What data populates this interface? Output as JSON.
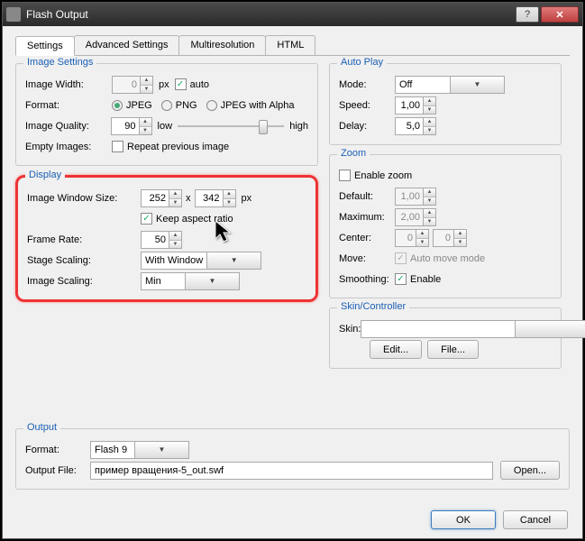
{
  "window": {
    "title": "Flash Output"
  },
  "tabs": [
    "Settings",
    "Advanced Settings",
    "Multiresolution",
    "HTML"
  ],
  "imageSettings": {
    "legend": "Image Settings",
    "width": {
      "label": "Image Width:",
      "value": "0",
      "unit": "px",
      "auto": "auto"
    },
    "format": {
      "label": "Format:",
      "options": [
        "JPEG",
        "PNG",
        "JPEG with Alpha"
      ],
      "selected": "JPEG"
    },
    "quality": {
      "label": "Image Quality:",
      "value": "90",
      "low": "low",
      "high": "high"
    },
    "empty": {
      "label": "Empty Images:",
      "checkbox": "Repeat previous image"
    }
  },
  "display": {
    "legend": "Display",
    "windowSize": {
      "label": "Image Window Size:",
      "w": "252",
      "sep": "x",
      "h": "342",
      "unit": "px"
    },
    "keepAspect": "Keep aspect ratio",
    "frameRate": {
      "label": "Frame Rate:",
      "value": "50"
    },
    "stageScaling": {
      "label": "Stage Scaling:",
      "value": "With Window"
    },
    "imageScaling": {
      "label": "Image Scaling:",
      "value": "Min"
    }
  },
  "autoPlay": {
    "legend": "Auto Play",
    "mode": {
      "label": "Mode:",
      "value": "Off"
    },
    "speed": {
      "label": "Speed:",
      "value": "1,00"
    },
    "delay": {
      "label": "Delay:",
      "value": "5,0"
    }
  },
  "zoom": {
    "legend": "Zoom",
    "enable": "Enable zoom",
    "default": {
      "label": "Default:",
      "value": "1,00"
    },
    "maximum": {
      "label": "Maximum:",
      "value": "2,00"
    },
    "center": {
      "label": "Center:",
      "x": "0",
      "y": "0"
    },
    "move": {
      "label": "Move:",
      "checkbox": "Auto move mode"
    },
    "smoothing": {
      "label": "Smoothing:",
      "checkbox": "Enable"
    }
  },
  "skin": {
    "legend": "Skin/Controller",
    "label": "Skin:",
    "value": "",
    "editBtn": "Edit...",
    "fileBtn": "File..."
  },
  "output": {
    "legend": "Output",
    "format": {
      "label": "Format:",
      "value": "Flash 9"
    },
    "file": {
      "label": "Output File:",
      "value": "пример вращения-5_out.swf"
    },
    "openBtn": "Open..."
  },
  "footer": {
    "ok": "OK",
    "cancel": "Cancel"
  }
}
